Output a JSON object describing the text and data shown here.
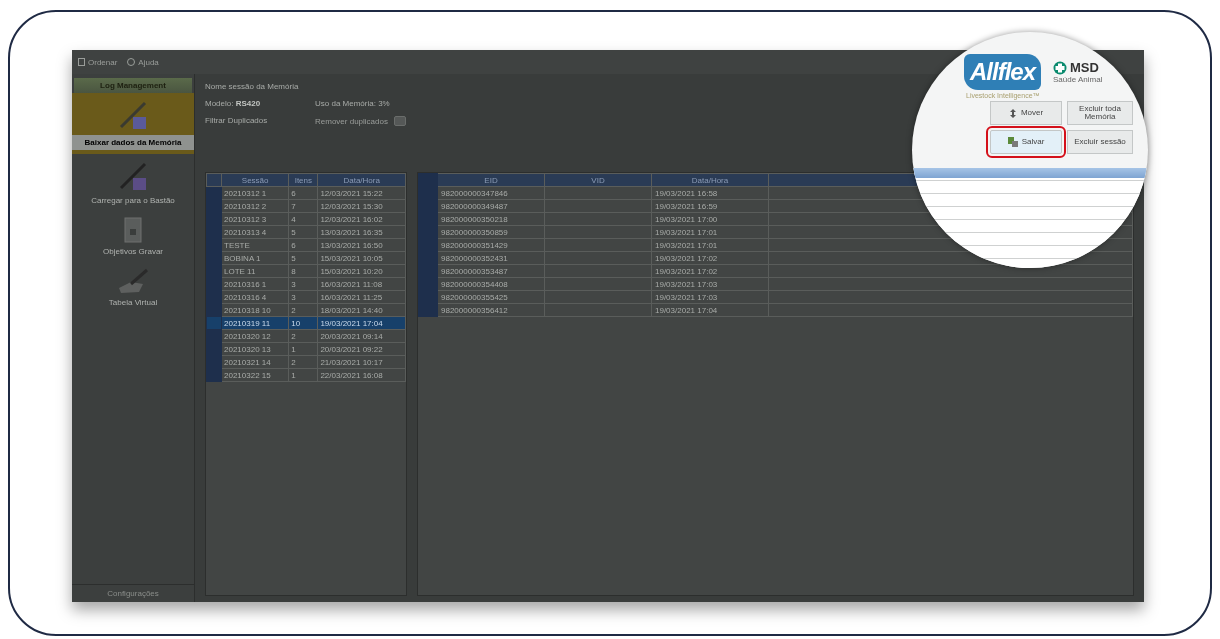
{
  "menu": [
    {
      "label": "Ordenar"
    },
    {
      "label": "Ajuda"
    }
  ],
  "sidebar": {
    "title": "Log Management",
    "items": [
      {
        "label": "Baixar dados da Memória",
        "kind": "download",
        "selected": true
      },
      {
        "label": "Carregar para o Bastão",
        "kind": "upload",
        "selected": false
      },
      {
        "label": "Objetivos Gravar",
        "kind": "file",
        "selected": false
      },
      {
        "label": "Tabela Virtual",
        "kind": "hand",
        "selected": false
      }
    ],
    "footer": "Configurações"
  },
  "session": {
    "title": "Nome sessão da Memória",
    "model_label": "Modelo:",
    "model": "RS420",
    "usage": "Uso da Memória: 3%",
    "filter_label": "Filtrar Duplicados",
    "filter_value": "Remover duplicados"
  },
  "sessions_table": {
    "columns": [
      "Sessão",
      "Itens",
      "Data/Hora"
    ],
    "rows": [
      {
        "cells": [
          "20210312 1",
          "6",
          "12/03/2021 15:22"
        ],
        "selected": false
      },
      {
        "cells": [
          "20210312 2",
          "7",
          "12/03/2021 15:30"
        ],
        "selected": false
      },
      {
        "cells": [
          "20210312 3",
          "4",
          "12/03/2021 16:02"
        ],
        "selected": false
      },
      {
        "cells": [
          "20210313 4",
          "5",
          "13/03/2021 16:35"
        ],
        "selected": false
      },
      {
        "cells": [
          "TESTE",
          "6",
          "13/03/2021 16:50"
        ],
        "selected": false
      },
      {
        "cells": [
          "BOBINA 1",
          "5",
          "15/03/2021 10:05"
        ],
        "selected": false
      },
      {
        "cells": [
          "LOTE 11",
          "8",
          "15/03/2021 10:20"
        ],
        "selected": false
      },
      {
        "cells": [
          "20210316 1",
          "3",
          "16/03/2021 11:08"
        ],
        "selected": false
      },
      {
        "cells": [
          "20210316 4",
          "3",
          "16/03/2021 11:25"
        ],
        "selected": false
      },
      {
        "cells": [
          "20210318 10",
          "2",
          "18/03/2021 14:40"
        ],
        "selected": false
      },
      {
        "cells": [
          "20210319 11",
          "10",
          "19/03/2021 17:04"
        ],
        "selected": true
      },
      {
        "cells": [
          "20210320 12",
          "2",
          "20/03/2021 09:14"
        ],
        "selected": false
      },
      {
        "cells": [
          "20210320 13",
          "1",
          "20/03/2021 09:22"
        ],
        "selected": false
      },
      {
        "cells": [
          "20210321 14",
          "2",
          "21/03/2021 10:17"
        ],
        "selected": false
      },
      {
        "cells": [
          "20210322 15",
          "1",
          "22/03/2021 16:08"
        ],
        "selected": false
      }
    ]
  },
  "tags_table": {
    "columns": [
      "EID",
      "VID",
      "Data/Hora"
    ],
    "rows": [
      {
        "eid": "982000000347846",
        "time": "19/03/2021 16:58"
      },
      {
        "eid": "982000000349487",
        "time": "19/03/2021 16:59"
      },
      {
        "eid": "982000000350218",
        "time": "19/03/2021 17:00"
      },
      {
        "eid": "982000000350859",
        "time": "19/03/2021 17:01"
      },
      {
        "eid": "982000000351429",
        "time": "19/03/2021 17:01"
      },
      {
        "eid": "982000000352431",
        "time": "19/03/2021 17:02"
      },
      {
        "eid": "982000000353487",
        "time": "19/03/2021 17:02"
      },
      {
        "eid": "982000000354408",
        "time": "19/03/2021 17:03"
      },
      {
        "eid": "982000000355425",
        "time": "19/03/2021 17:03"
      },
      {
        "eid": "982000000356412",
        "time": "19/03/2021 17:04"
      }
    ]
  },
  "magnifier": {
    "brand": "Allflex",
    "tagline": "Livestock Intelligence™",
    "partner": "MSD",
    "partner_sub": "Saúde Animal",
    "buttons": [
      {
        "label": "Mover",
        "highlighted": false
      },
      {
        "label": "Excluir toda Memória",
        "highlighted": false
      },
      {
        "label": "Salvar",
        "highlighted": true
      },
      {
        "label": "Excluir sessão",
        "highlighted": false
      }
    ]
  }
}
